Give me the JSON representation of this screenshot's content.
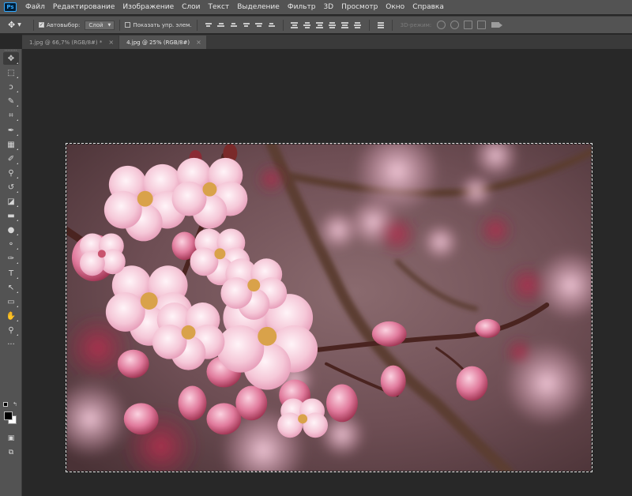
{
  "app": {
    "logo_text": "Ps",
    "menu": [
      "Файл",
      "Редактирование",
      "Изображение",
      "Слои",
      "Текст",
      "Выделение",
      "Фильтр",
      "3D",
      "Просмотр",
      "Окно",
      "Справка"
    ]
  },
  "options": {
    "autoselect_label": "Автовыбор:",
    "autoselect_checked": true,
    "autoselect_target": "Слой",
    "show_transform_label": "Показать упр. элем.",
    "show_transform_checked": false,
    "mode3d_label": "3D-режим:"
  },
  "tabs": [
    {
      "label": "1.jpg @ 66,7% (RGB/8#) *",
      "active": false
    },
    {
      "label": "4.jpg @ 25% (RGB/8#)",
      "active": true
    }
  ],
  "tools": [
    {
      "name": "move-tool",
      "icon": "✥",
      "selected": true
    },
    {
      "name": "marquee-tool",
      "icon": "⬚"
    },
    {
      "name": "lasso-tool",
      "icon": "ↄ"
    },
    {
      "name": "quick-select-tool",
      "icon": "✎"
    },
    {
      "name": "crop-tool",
      "icon": "⌗"
    },
    {
      "name": "eyedropper-tool",
      "icon": "✒"
    },
    {
      "name": "healing-brush-tool",
      "icon": "▦"
    },
    {
      "name": "brush-tool",
      "icon": "✐"
    },
    {
      "name": "clone-stamp-tool",
      "icon": "⚲"
    },
    {
      "name": "history-brush-tool",
      "icon": "↺"
    },
    {
      "name": "eraser-tool",
      "icon": "◪"
    },
    {
      "name": "gradient-tool",
      "icon": "▬"
    },
    {
      "name": "blur-tool",
      "icon": "●"
    },
    {
      "name": "dodge-tool",
      "icon": "⚬"
    },
    {
      "name": "pen-tool",
      "icon": "✑"
    },
    {
      "name": "type-tool",
      "icon": "T"
    },
    {
      "name": "path-select-tool",
      "icon": "↖"
    },
    {
      "name": "rectangle-tool",
      "icon": "▭"
    },
    {
      "name": "hand-tool",
      "icon": "✋"
    },
    {
      "name": "zoom-tool",
      "icon": "⚲"
    },
    {
      "name": "more-tools",
      "icon": "···"
    }
  ],
  "colors": {
    "foreground": "#000000",
    "background": "#ffffff",
    "ui_panel": "#535353",
    "workspace": "#282828"
  }
}
